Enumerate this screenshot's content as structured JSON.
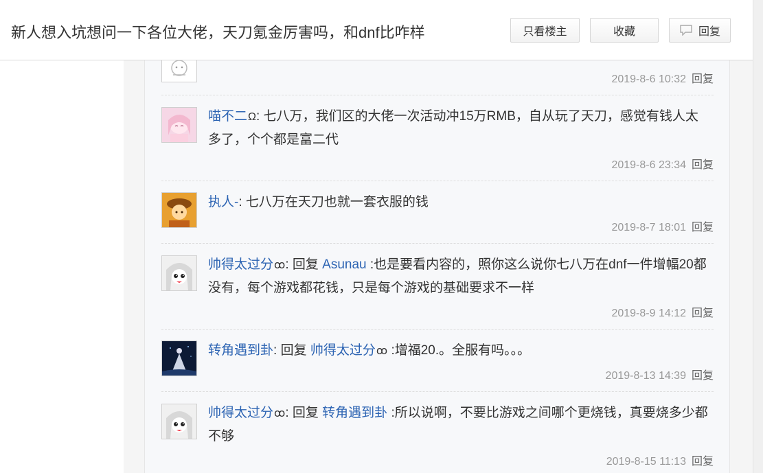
{
  "header": {
    "title": "新人想入坑想问一下各位大佬，天刀氪金厉害吗，和dnf比咋样",
    "only_owner_label": "只看楼主",
    "favorite_label": "收藏",
    "reply_label": "回复"
  },
  "comments": [
    {
      "user": "",
      "text": "",
      "time": "2019-8-6 10:32",
      "reply_label": "回复"
    },
    {
      "user": "喵不二",
      "badge": "Ω",
      "colon": ": ",
      "text": "七八万，我们区的大佬一次活动冲15万RMB，自从玩了天刀，感觉有钱人太多了，个个都是富二代",
      "time": "2019-8-6 23:34",
      "reply_label": "回复"
    },
    {
      "user": "执人-",
      "colon": ": ",
      "text": "七八万在天刀也就一套衣服的钱",
      "time": "2019-8-7 18:01",
      "reply_label": "回复"
    },
    {
      "user": "帅得太过分",
      "badge": "ꝏ",
      "colon": ": ",
      "reply_word": "回复 ",
      "target": "Asunau",
      "text": " :也是要看内容的，照你这么说你七八万在dnf一件增幅20都没有，每个游戏都花钱，只是每个游戏的基础要求不一样",
      "time": "2019-8-9 14:12",
      "reply_label": "回复"
    },
    {
      "user": "转角遇到卦",
      "colon": ": ",
      "reply_word": "回复 ",
      "target": "帅得太过分",
      "target_badge": "ꝏ",
      "text": " :增福20.。全服有吗。。。",
      "time": "2019-8-13 14:39",
      "reply_label": "回复"
    },
    {
      "user": "帅得太过分",
      "badge": "ꝏ",
      "colon": ": ",
      "reply_word": "回复 ",
      "target": "转角遇到卦",
      "text": " :所以说啊，不要比游戏之间哪个更烧钱，真要烧多少都不够",
      "time": "2019-8-15 11:13",
      "reply_label": "回复"
    }
  ]
}
